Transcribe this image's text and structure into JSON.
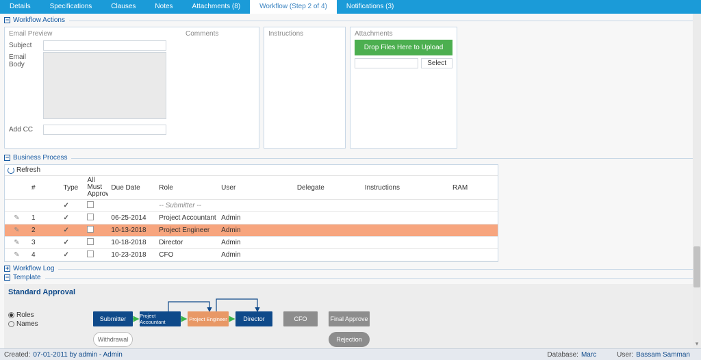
{
  "tabs": [
    {
      "label": "Details"
    },
    {
      "label": "Specifications"
    },
    {
      "label": "Clauses"
    },
    {
      "label": "Notes"
    },
    {
      "label": "Attachments (8)"
    },
    {
      "label": "Workflow (Step 2 of 4)",
      "active": true
    },
    {
      "label": "Notifications (3)"
    }
  ],
  "sections": {
    "workflow_actions": "Workflow Actions",
    "business_process": "Business Process",
    "workflow_log": "Workflow Log",
    "template": "Template"
  },
  "email_panel": {
    "header": "Email Preview",
    "subject_label": "Subject",
    "body_label": "Email Body",
    "addcc_label": "Add CC"
  },
  "comments_panel": {
    "header": "Comments"
  },
  "instructions_panel": {
    "header": "Instructions"
  },
  "attachments_panel": {
    "header": "Attachments",
    "drop_text": "Drop Files Here to Upload",
    "select_btn": "Select"
  },
  "grid": {
    "refresh": "Refresh",
    "cols": {
      "num": "#",
      "type": "Type",
      "all": "All Must Approve",
      "due": "Due Date",
      "role": "Role",
      "user": "User",
      "delegate": "Delegate",
      "instructions": "Instructions",
      "ram": "RAM"
    },
    "submitter_row": "-- Submitter --",
    "rows": [
      {
        "n": "1",
        "due": "06-25-2014",
        "role": "Project Accountant",
        "user": "Admin",
        "hi": false
      },
      {
        "n": "2",
        "due": "10-13-2018",
        "role": "Project Engineer",
        "user": "Admin",
        "hi": true
      },
      {
        "n": "3",
        "due": "10-18-2018",
        "role": "Director",
        "user": "Admin",
        "hi": false
      },
      {
        "n": "4",
        "due": "10-23-2018",
        "role": "CFO",
        "user": "Admin",
        "hi": false
      }
    ]
  },
  "template_block": {
    "title": "Standard Approval",
    "radio_roles": "Roles",
    "radio_names": "Names",
    "nodes": {
      "submitter": "Submitter",
      "pa": "Project Accountant",
      "pe": "Project Engineer",
      "director": "Director",
      "cfo": "CFO",
      "final": "Final Approve",
      "withdrawal": "Withdrawal",
      "rejection": "Rejection"
    }
  },
  "status": {
    "created_k": "Created:",
    "created_v": "07-01-2011 by admin - Admin",
    "db_k": "Database:",
    "db_v": "Marc",
    "user_k": "User:",
    "user_v": "Bassam Samman"
  }
}
